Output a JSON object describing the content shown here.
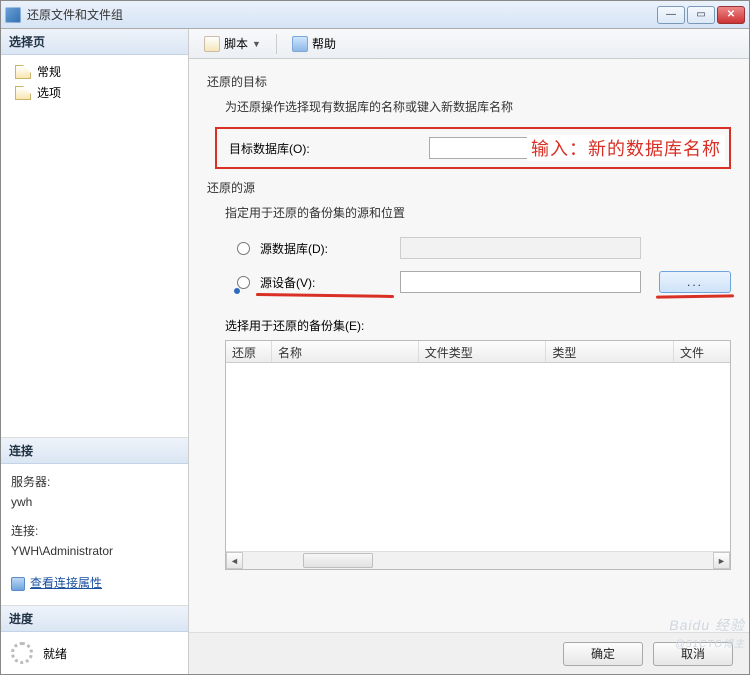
{
  "window": {
    "title": "还原文件和文件组"
  },
  "sidebar": {
    "header": "选择页",
    "items": [
      {
        "label": "常规"
      },
      {
        "label": "选项"
      }
    ]
  },
  "connection": {
    "header": "连接",
    "server_label": "服务器:",
    "server_value": "ywh",
    "conn_label": "连接:",
    "conn_value": "YWH\\Administrator",
    "view_props": "查看连接属性"
  },
  "progress": {
    "header": "进度",
    "status": "就绪"
  },
  "toolbar": {
    "script": "脚本",
    "help": "帮助"
  },
  "target": {
    "group": "还原的目标",
    "sub": "为还原操作选择现有数据库的名称或键入新数据库名称",
    "label": "目标数据库(O):",
    "annotation": "输入：新的数据库名称"
  },
  "source": {
    "group": "还原的源",
    "sub": "指定用于还原的备份集的源和位置",
    "radio_db": "源数据库(D):",
    "radio_device": "源设备(V):",
    "browse": "..."
  },
  "backupsets": {
    "label": "选择用于还原的备份集(E):",
    "cols": [
      "还原",
      "名称",
      "文件类型",
      "类型",
      "文件"
    ]
  },
  "buttons": {
    "ok": "确定",
    "cancel": "取消"
  },
  "watermark": {
    "brand": "Baidu 经验",
    "sub": "@51CTO博主"
  }
}
